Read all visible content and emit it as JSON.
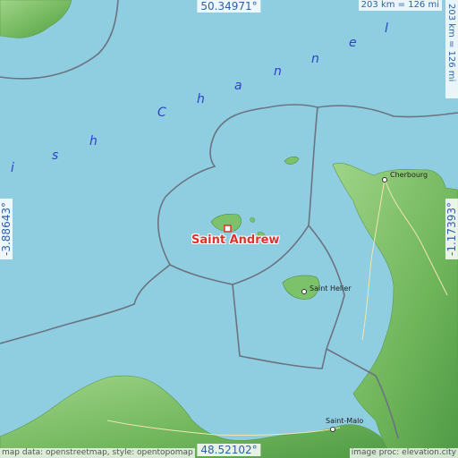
{
  "map": {
    "coords": {
      "top": "50.34971°",
      "bottom": "48.52102°",
      "left": "-3.88643°",
      "right": "-1.17393°"
    },
    "scale": {
      "top": "203 km = 126 mi",
      "side": "203 km = 126 mi"
    },
    "attribution": {
      "left": "map data: openstreetmap, style: opentopomap",
      "right": "image proc: elevation.city"
    },
    "target": "Saint Andrew",
    "places": [
      "Cherbourg",
      "Saint Helier",
      "Saint-Malo"
    ],
    "sea_name_letters": [
      "i",
      "s",
      "h",
      "C",
      "h",
      "a",
      "n",
      "n",
      "e",
      "l"
    ],
    "colors": {
      "sea": "#8fcde0",
      "land": "#7cc26a",
      "boundary": "#6b7380",
      "label": "#e0322a",
      "coord_text": "#2f5fa8"
    },
    "icons": [
      "city-marker-icon",
      "target-marker-icon"
    ]
  }
}
